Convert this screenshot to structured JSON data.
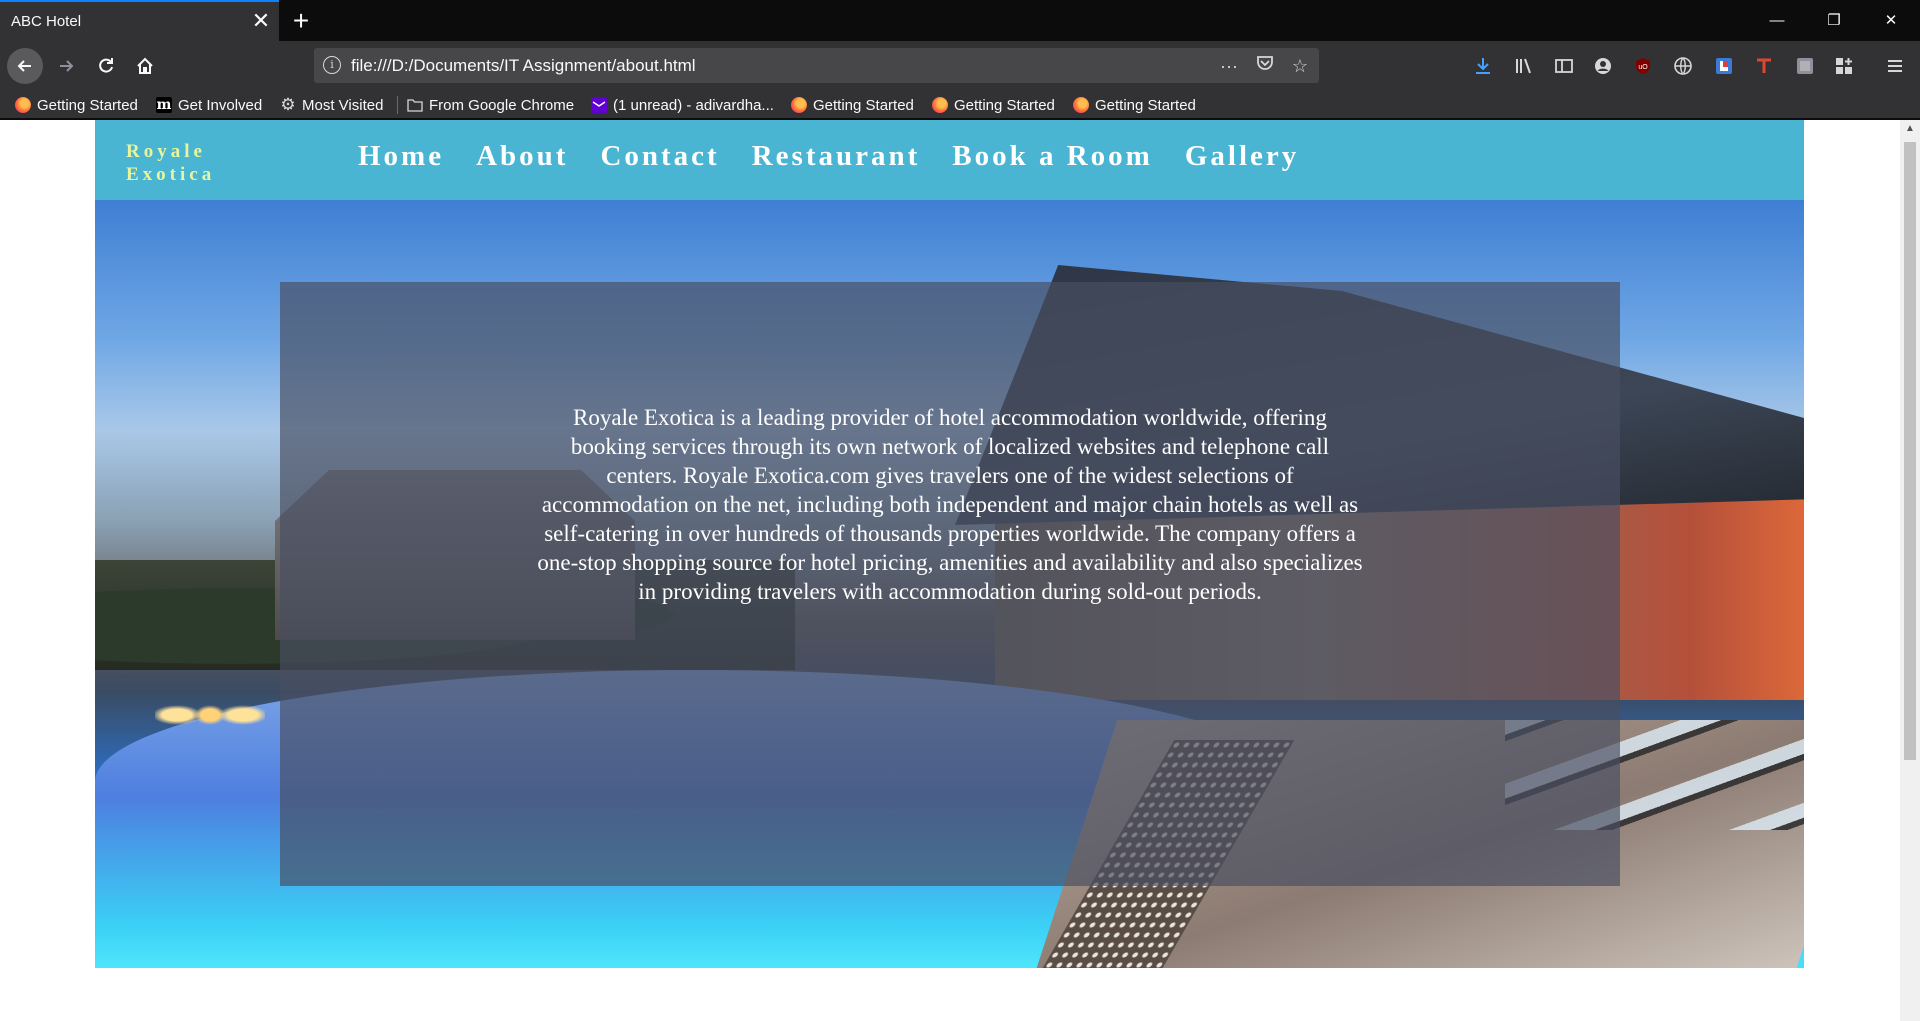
{
  "browser": {
    "tab_title": "ABC Hotel",
    "tab_close_icon": "close-icon",
    "new_tab_icon": "plus-icon",
    "url": "file:///D:/Documents/IT Assignment/about.html",
    "bookmarks": [
      {
        "label": "Getting Started",
        "icon": "firefox-icon"
      },
      {
        "label": "Get Involved",
        "icon": "mozilla-icon"
      },
      {
        "label": "Most Visited",
        "icon": "gear-icon"
      },
      {
        "label": "From Google Chrome",
        "icon": "folder-icon"
      },
      {
        "label": "(1 unread) - adivardha...",
        "icon": "mail-icon"
      },
      {
        "label": "Getting Started",
        "icon": "firefox-icon"
      },
      {
        "label": "Getting Started",
        "icon": "firefox-icon"
      },
      {
        "label": "Getting Started",
        "icon": "firefox-icon"
      }
    ]
  },
  "site": {
    "logo": [
      "Royale",
      "Exotica"
    ],
    "menu": [
      "Home",
      "About",
      "Contact",
      "Restaurant",
      "Book a Room",
      "Gallery"
    ],
    "about_text": "Royale Exotica is a leading provider of hotel accommodation worldwide, offering booking services through its own network of localized websites and telephone call centers. Royale Exotica.com gives travelers one of the widest selections of accommodation on the net, including both independent and major chain hotels as well as self-catering in over hundreds of thousands properties worldwide. The company offers a one-stop shopping source for hotel pricing, amenities and availability and also specializes in providing travelers with accommodation during sold-out periods."
  },
  "colors": {
    "header_bg": "#4ab5d3",
    "logo_color": "#e8f59a",
    "overlay": "rgba(72, 78, 98, 0.68)"
  }
}
